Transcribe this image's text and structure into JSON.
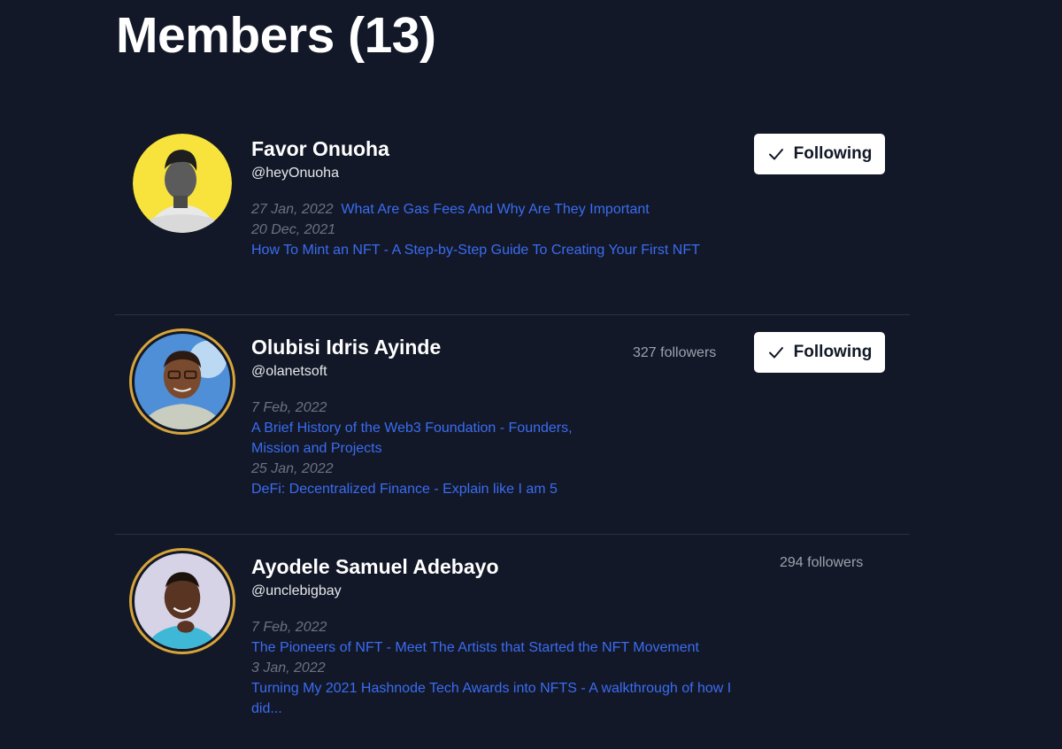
{
  "header": {
    "title": "Members (13)"
  },
  "members": [
    {
      "name": "Favor Onuoha",
      "handle": "@heyOnuoha",
      "followers": "",
      "button": "Following",
      "posts": [
        {
          "date": "27 Jan, 2022",
          "title": "What Are Gas Fees And Why Are They Important"
        },
        {
          "date": "20 Dec, 2021",
          "title": "How To Mint an NFT - A Step-by-Step Guide To Creating Your First NFT"
        }
      ]
    },
    {
      "name": "Olubisi Idris Ayinde",
      "handle": "@olanetsoft",
      "followers": "327 followers",
      "button": "Following",
      "posts": [
        {
          "date": "7 Feb, 2022",
          "title": "A Brief History of the Web3 Foundation - Founders, Mission and Projects"
        },
        {
          "date": "25 Jan, 2022",
          "title": "DeFi: Decentralized Finance - Explain like I am 5"
        }
      ]
    },
    {
      "name": "Ayodele Samuel Adebayo",
      "handle": "@unclebigbay",
      "followers": "294 followers",
      "button": "",
      "posts": [
        {
          "date": "7 Feb, 2022",
          "title": "The Pioneers of NFT - Meet The Artists that Started the NFT Movement"
        },
        {
          "date": "3 Jan, 2022",
          "title": "Turning My 2021 Hashnode Tech Awards into NFTS - A walkthrough of how I did..."
        }
      ]
    }
  ],
  "colors": {
    "background": "#121827",
    "link": "#3b6cf2",
    "date": "#6b7280",
    "avatar_ring": "#d7a43a",
    "avatar_1_bg": "#f7e33b"
  },
  "icons": {
    "following_button": "check-icon"
  }
}
